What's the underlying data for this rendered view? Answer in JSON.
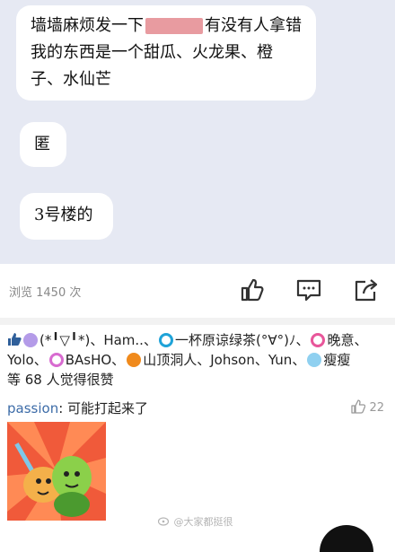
{
  "chat": {
    "message1_before": "墙墙麻烦发一下",
    "message1_after": "有没有人拿错我的东西是一个甜瓜、火龙果、橙子、水仙芒",
    "message2": "匿",
    "message3": "3号楼的"
  },
  "post_meta": {
    "views": "浏览 1450 次"
  },
  "likes": {
    "names": [
      "(*╹▽╹*)",
      "Ham..",
      "一杯原谅绿茶(°∀°)ﾉ",
      "晚意",
      "Yolo",
      "BAsHO",
      "山顶洞人",
      "Johson",
      "Yun",
      "瘦瘦"
    ],
    "summary": "等 68 人觉得很赞"
  },
  "comment": {
    "author": "passion",
    "text": ": 可能打起来了",
    "like_count": "22"
  },
  "watermark": "@大家都挺很",
  "colors": {
    "chat_bg": "#e6e9f3",
    "link": "#3d6ca8",
    "redaction": "#e07a80"
  }
}
